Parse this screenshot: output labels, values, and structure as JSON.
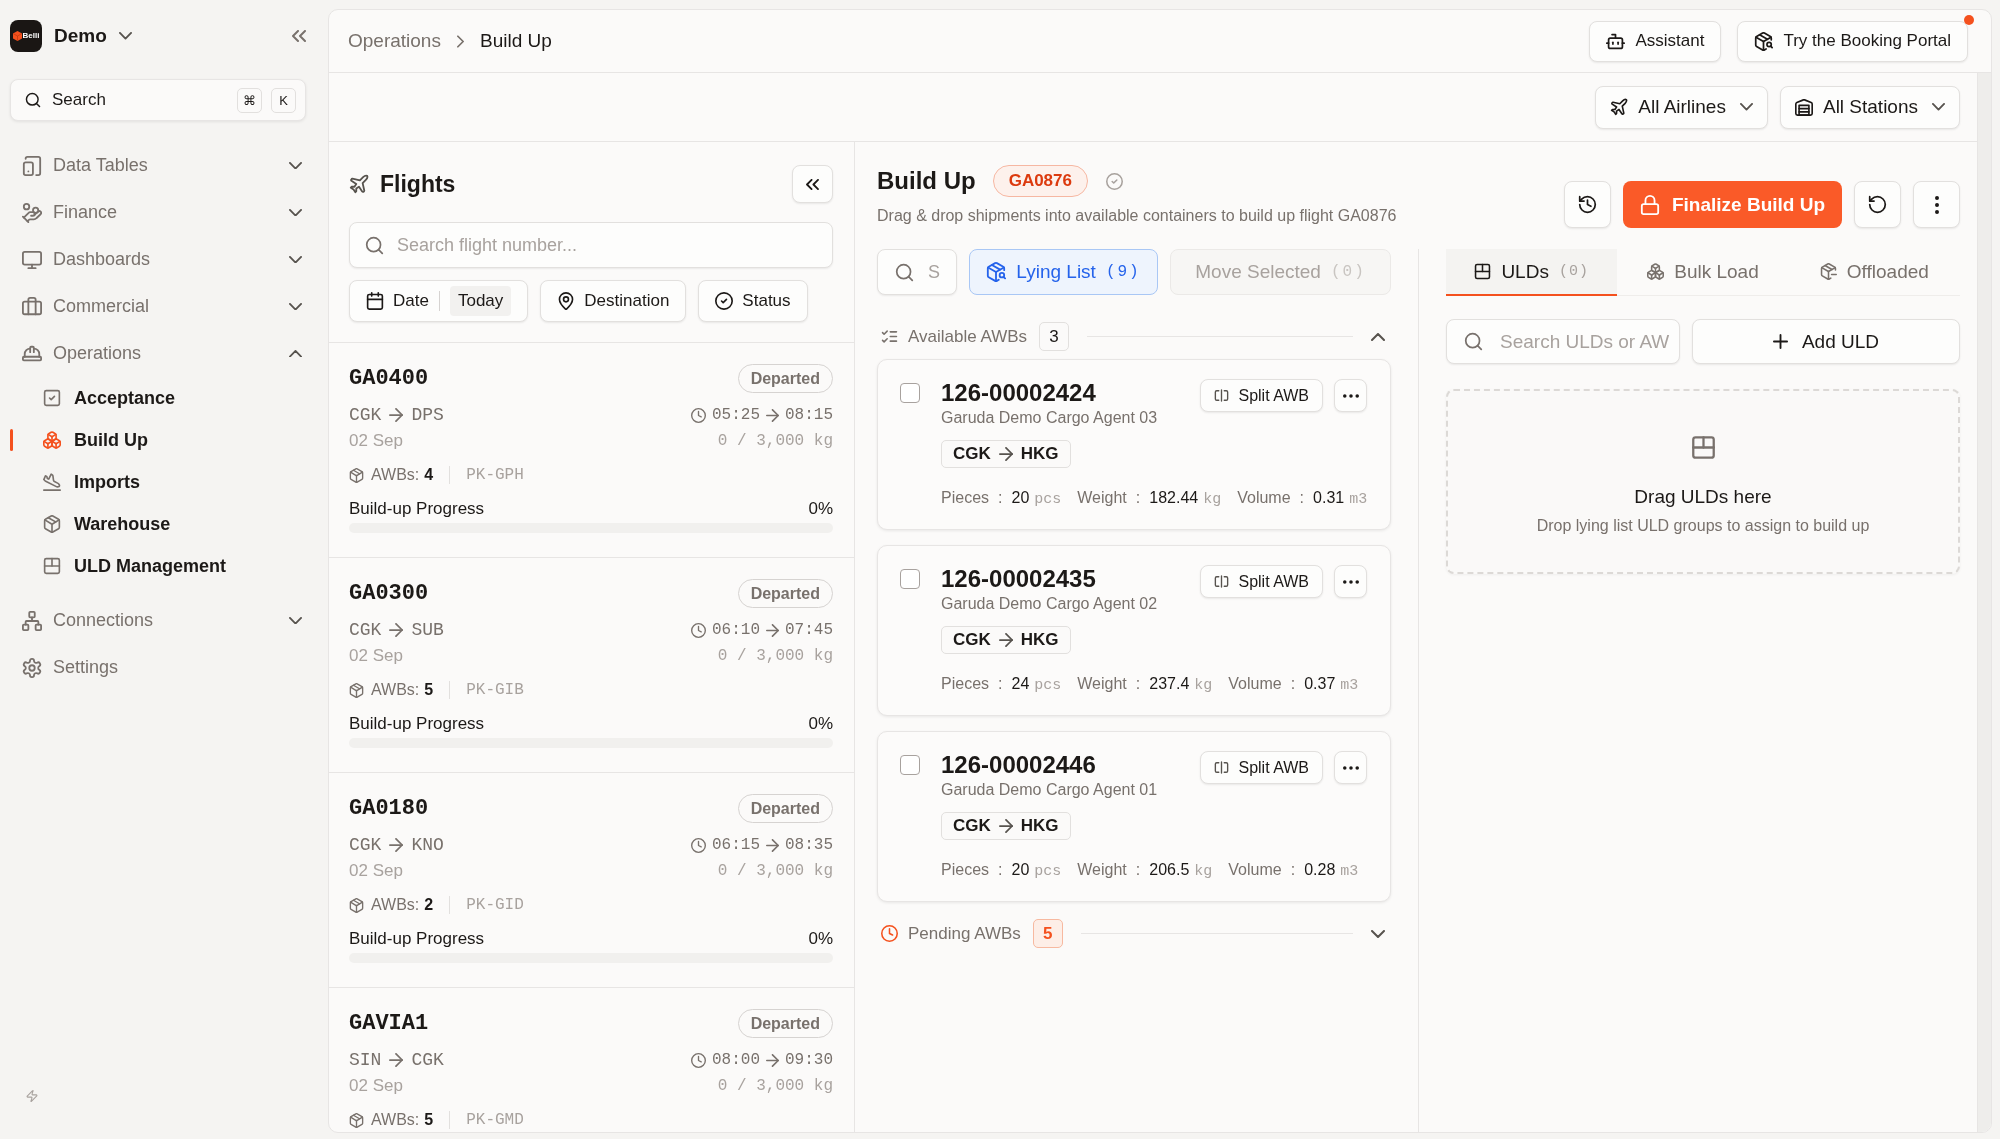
{
  "sidebar": {
    "logo_text": "Belli",
    "workspace": "Demo",
    "search": {
      "label": "Search",
      "keys": [
        "⌘",
        "K"
      ]
    },
    "nav": [
      {
        "label": "Data Tables",
        "expanded": false,
        "selected": false
      },
      {
        "label": "Finance",
        "expanded": false,
        "selected": false
      },
      {
        "label": "Dashboards",
        "expanded": false,
        "selected": false
      },
      {
        "label": "Commercial",
        "expanded": false,
        "selected": false
      },
      {
        "label": "Operations",
        "expanded": true,
        "selected": false,
        "children": [
          {
            "label": "Acceptance",
            "selected": false
          },
          {
            "label": "Build Up",
            "selected": true
          },
          {
            "label": "Imports",
            "selected": false
          },
          {
            "label": "Warehouse",
            "selected": false
          },
          {
            "label": "ULD Management",
            "selected": false
          }
        ]
      },
      {
        "label": "Connections",
        "expanded": false,
        "selected": false
      },
      {
        "label": "Settings",
        "selected": false
      }
    ]
  },
  "topbar": {
    "breadcrumb": [
      "Operations",
      "Build Up"
    ],
    "buttons": [
      {
        "label": "Assistant",
        "notification": false
      },
      {
        "label": "Try the Booking Portal",
        "notification": true
      }
    ]
  },
  "filter_bar": {
    "dropdowns": [
      {
        "label": "All Airlines"
      },
      {
        "label": "All Stations"
      }
    ]
  },
  "flights_panel": {
    "title": "Flights",
    "search": {
      "placeholder": "Search flight number..."
    },
    "filters": [
      {
        "label": "Date",
        "value": "Today"
      },
      {
        "label": "Destination"
      },
      {
        "label": "Status"
      }
    ],
    "flights": [
      {
        "number": "GA0400",
        "status": "Departed",
        "selected": false,
        "origin": "CGK",
        "destination": "DPS",
        "departure": "05:25",
        "arrival": "08:15",
        "date": "02 Sep",
        "load": "0 / 3,000 kg",
        "awbs_label": "AWBs:",
        "awbs": "4",
        "registration": "PK-GPH",
        "progress_label": "Build-up Progress",
        "progress": "0%",
        "level": 0
      },
      {
        "number": "GA0300",
        "status": "Departed",
        "selected": false,
        "origin": "CGK",
        "destination": "SUB",
        "departure": "06:10",
        "arrival": "07:45",
        "date": "02 Sep",
        "load": "0 / 3,000 kg",
        "awbs_label": "AWBs:",
        "awbs": "5",
        "registration": "PK-GIB",
        "progress_label": "Build-up Progress",
        "progress": "0%",
        "level": 0
      },
      {
        "number": "GA0180",
        "status": "Departed",
        "selected": false,
        "origin": "CGK",
        "destination": "KNO",
        "departure": "06:15",
        "arrival": "08:35",
        "date": "02 Sep",
        "load": "0 / 3,000 kg",
        "awbs_label": "AWBs:",
        "awbs": "2",
        "registration": "PK-GID",
        "progress_label": "Build-up Progress",
        "progress": "0%",
        "level": 0
      },
      {
        "number": "GAVIA1",
        "status": "Departed",
        "selected": false,
        "origin": "SIN",
        "destination": "CGK",
        "departure": "08:00",
        "arrival": "09:30",
        "date": "02 Sep",
        "load": "0 / 3,000 kg",
        "awbs_label": "AWBs:",
        "awbs": "5",
        "registration": "PK-GMD"
      }
    ]
  },
  "build_up": {
    "title": "Build Up",
    "flight": "GA0876",
    "subtitle": "Drag & drop shipments into available containers to build up flight GA0876",
    "finalize_label": "Finalize Build Up",
    "lying": {
      "search": {
        "placeholder": "S"
      },
      "lying_list": {
        "label": "Lying List",
        "count": "(9)",
        "active": true
      },
      "move_selected": {
        "label": "Move Selected",
        "count": "(0)",
        "disabled": true
      },
      "sections": [
        {
          "kind": "available",
          "title": "Available AWBs",
          "count": "3",
          "expanded": true,
          "awbs": [
            {
              "number": "126-00002424",
              "checked": false,
              "agent": "Garuda Demo Cargo Agent 03",
              "origin": "CGK",
              "destination": "HKG",
              "split_label": "Split AWB",
              "stats": [
                {
                  "label": "Pieces",
                  "separator": ":",
                  "value": "20",
                  "unit": "pcs"
                },
                {
                  "label": "Weight",
                  "separator": ":",
                  "value": "182.44",
                  "unit": "kg"
                },
                {
                  "label": "Volume",
                  "separator": ":",
                  "value": "0.31",
                  "unit": "m3"
                }
              ]
            },
            {
              "number": "126-00002435",
              "checked": false,
              "agent": "Garuda Demo Cargo Agent 02",
              "origin": "CGK",
              "destination": "HKG",
              "split_label": "Split AWB",
              "stats": [
                {
                  "label": "Pieces",
                  "separator": ":",
                  "value": "24",
                  "unit": "pcs"
                },
                {
                  "label": "Weight",
                  "separator": ":",
                  "value": "237.4",
                  "unit": "kg"
                },
                {
                  "label": "Volume",
                  "separator": ":",
                  "value": "0.37",
                  "unit": "m3"
                }
              ]
            },
            {
              "number": "126-00002446",
              "checked": false,
              "agent": "Garuda Demo Cargo Agent 01",
              "origin": "CGK",
              "destination": "HKG",
              "split_label": "Split AWB",
              "stats": [
                {
                  "label": "Pieces",
                  "separator": ":",
                  "value": "20",
                  "unit": "pcs"
                },
                {
                  "label": "Weight",
                  "separator": ":",
                  "value": "206.5",
                  "unit": "kg"
                },
                {
                  "label": "Volume",
                  "separator": ":",
                  "value": "0.28",
                  "unit": "m3"
                }
              ]
            }
          ]
        },
        {
          "kind": "pending",
          "title": "Pending AWBs",
          "count": "5",
          "expanded": false
        }
      ]
    },
    "ulds": {
      "tabs": [
        {
          "label": "ULDs",
          "count": "(0)",
          "selected": true
        },
        {
          "label": "Bulk Load",
          "selected": false
        },
        {
          "label": "Offloaded",
          "selected": false
        }
      ],
      "search": {
        "placeholder": "Search ULDs or AW"
      },
      "add_label": "Add ULD",
      "dropzone": {
        "title": "Drag ULDs here",
        "text": "Drop lying list ULD groups to assign to build up"
      }
    }
  }
}
